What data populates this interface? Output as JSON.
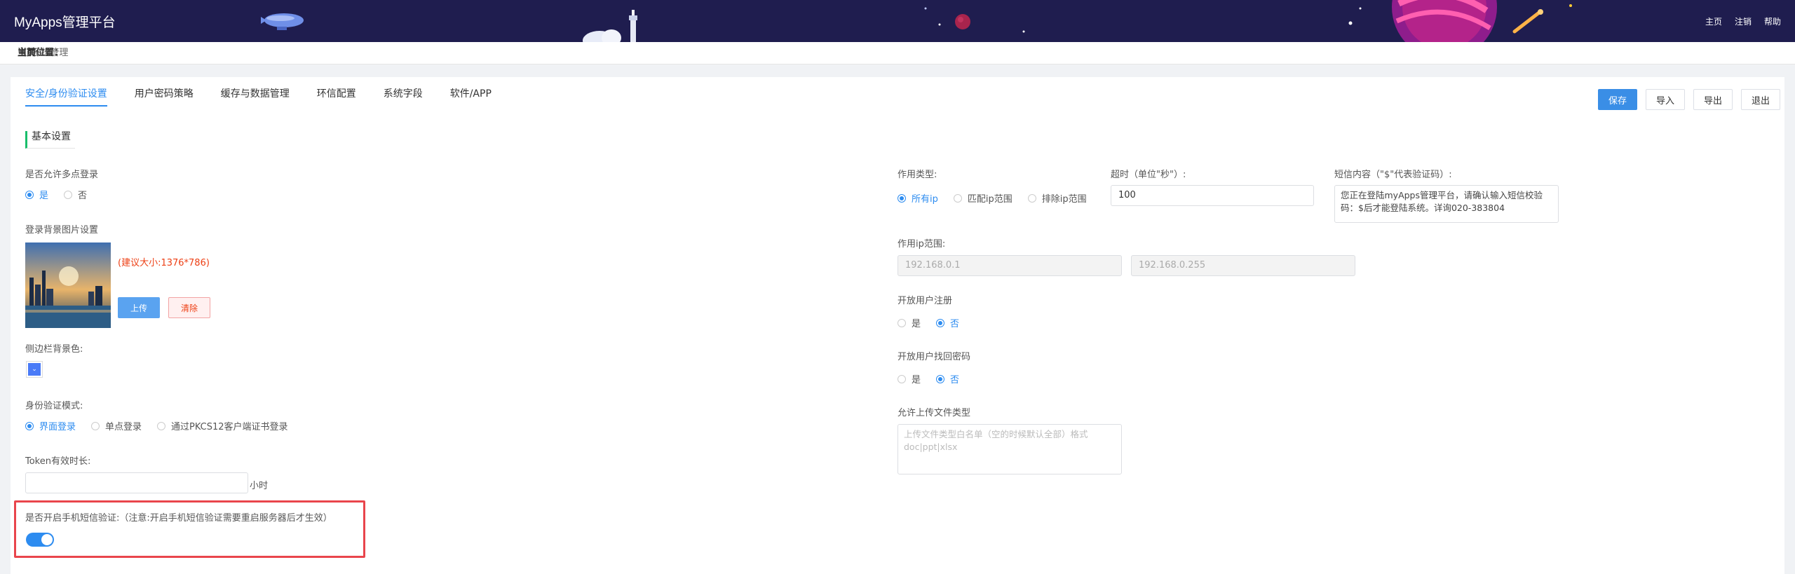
{
  "header": {
    "brand": "MyApps管理平台",
    "nav": [
      "主页",
      "注销",
      "帮助"
    ]
  },
  "breadcrumb": {
    "label": "当前位置：",
    "home": "主页",
    "separator": "/",
    "current": "系统管理"
  },
  "tabs": [
    "安全/身份验证设置",
    "用户密码策略",
    "缓存与数据管理",
    "环信配置",
    "系统字段",
    "软件/APP"
  ],
  "active_tab": 0,
  "actions": {
    "save": "保存",
    "import": "导入",
    "export": "导出",
    "exit": "退出"
  },
  "section_title": "基本设置",
  "left": {
    "multi_login_label": "是否允许多点登录",
    "multi_login_options": [
      "是",
      "否"
    ],
    "multi_login_selected": 0,
    "bg_image_label": "登录背景图片设置",
    "bg_image_hint": "(建议大小:1376*786)",
    "upload_label": "上传",
    "clear_label": "清除",
    "sidebar_color_label": "侧边栏背景色:",
    "sidebar_color": "#4a7bf7",
    "sidebar_color_glyph": "⌄",
    "auth_mode_label": "身份验证模式:",
    "auth_mode_options": [
      "界面登录",
      "单点登录",
      "通过PKCS12客户端证书登录"
    ],
    "auth_mode_selected": 0,
    "token_label": "Token有效时长:",
    "token_value": "",
    "token_unit": "小时",
    "sms_label": "是否开启手机短信验证:（注意:开启手机短信验证需要重启服务器后才生效）",
    "sms_enabled": true
  },
  "right": {
    "scope_label": "作用类型:",
    "scope_options": [
      "所有ip",
      "匹配ip范围",
      "排除ip范围"
    ],
    "scope_selected": 0,
    "timeout_label": "超时（单位\"秒\"）:",
    "timeout_value": "100",
    "sms_content_label": "短信内容（\"$\"代表验证码）:",
    "sms_content_value": "您正在登陆myApps管理平台，请确认输入短信校验码：$后才能登陆系统。详询020-383804",
    "ip_range_label": "作用ip范围:",
    "ip_start": "192.168.0.1",
    "ip_end": "192.168.0.255",
    "register_label": "开放用户注册",
    "register_options": [
      "是",
      "否"
    ],
    "register_selected": 1,
    "recover_label": "开放用户找回密码",
    "recover_options": [
      "是",
      "否"
    ],
    "recover_selected": 1,
    "upload_types_label": "允许上传文件类型",
    "upload_types_placeholder": "上传文件类型白名单（空的时候默认全部）格式doc|ppt|xlsx"
  },
  "colors": {
    "header_bg": "#1f1d4f",
    "accent": "#2d8cf0",
    "danger": "#ed3f14",
    "highlight_border": "#e9454c"
  }
}
